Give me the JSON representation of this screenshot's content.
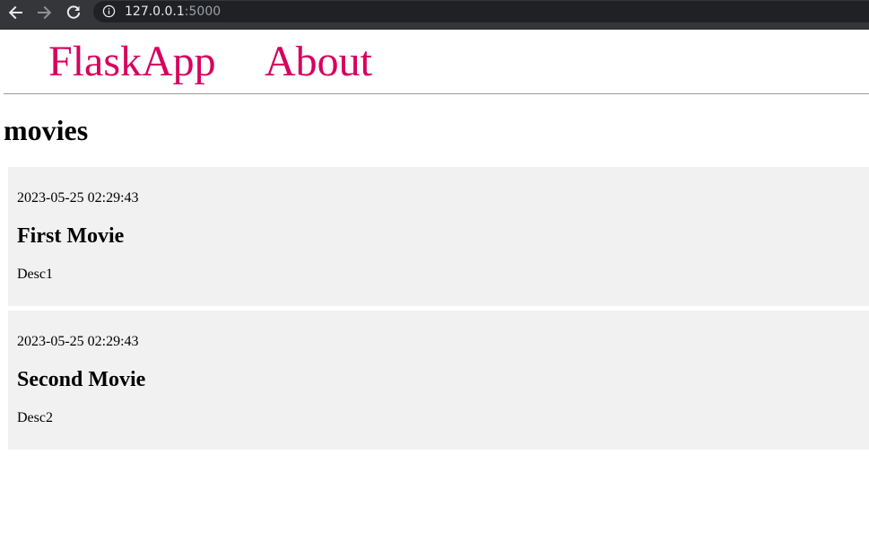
{
  "browser": {
    "url_host": "127.0.0.1",
    "url_port": ":5000",
    "icons": {
      "back": "arrow-left-icon",
      "forward": "arrow-right-icon",
      "reload": "reload-icon",
      "info": "info-icon"
    }
  },
  "nav": {
    "home_label": "FlaskApp",
    "about_label": "About",
    "link_color": "#d6005f"
  },
  "main": {
    "heading": "movies",
    "posts": [
      {
        "date": "2023-05-25 02:29:43",
        "title": "First Movie",
        "description": "Desc1"
      },
      {
        "date": "2023-05-25 02:29:43",
        "title": "Second Movie",
        "description": "Desc2"
      }
    ]
  }
}
